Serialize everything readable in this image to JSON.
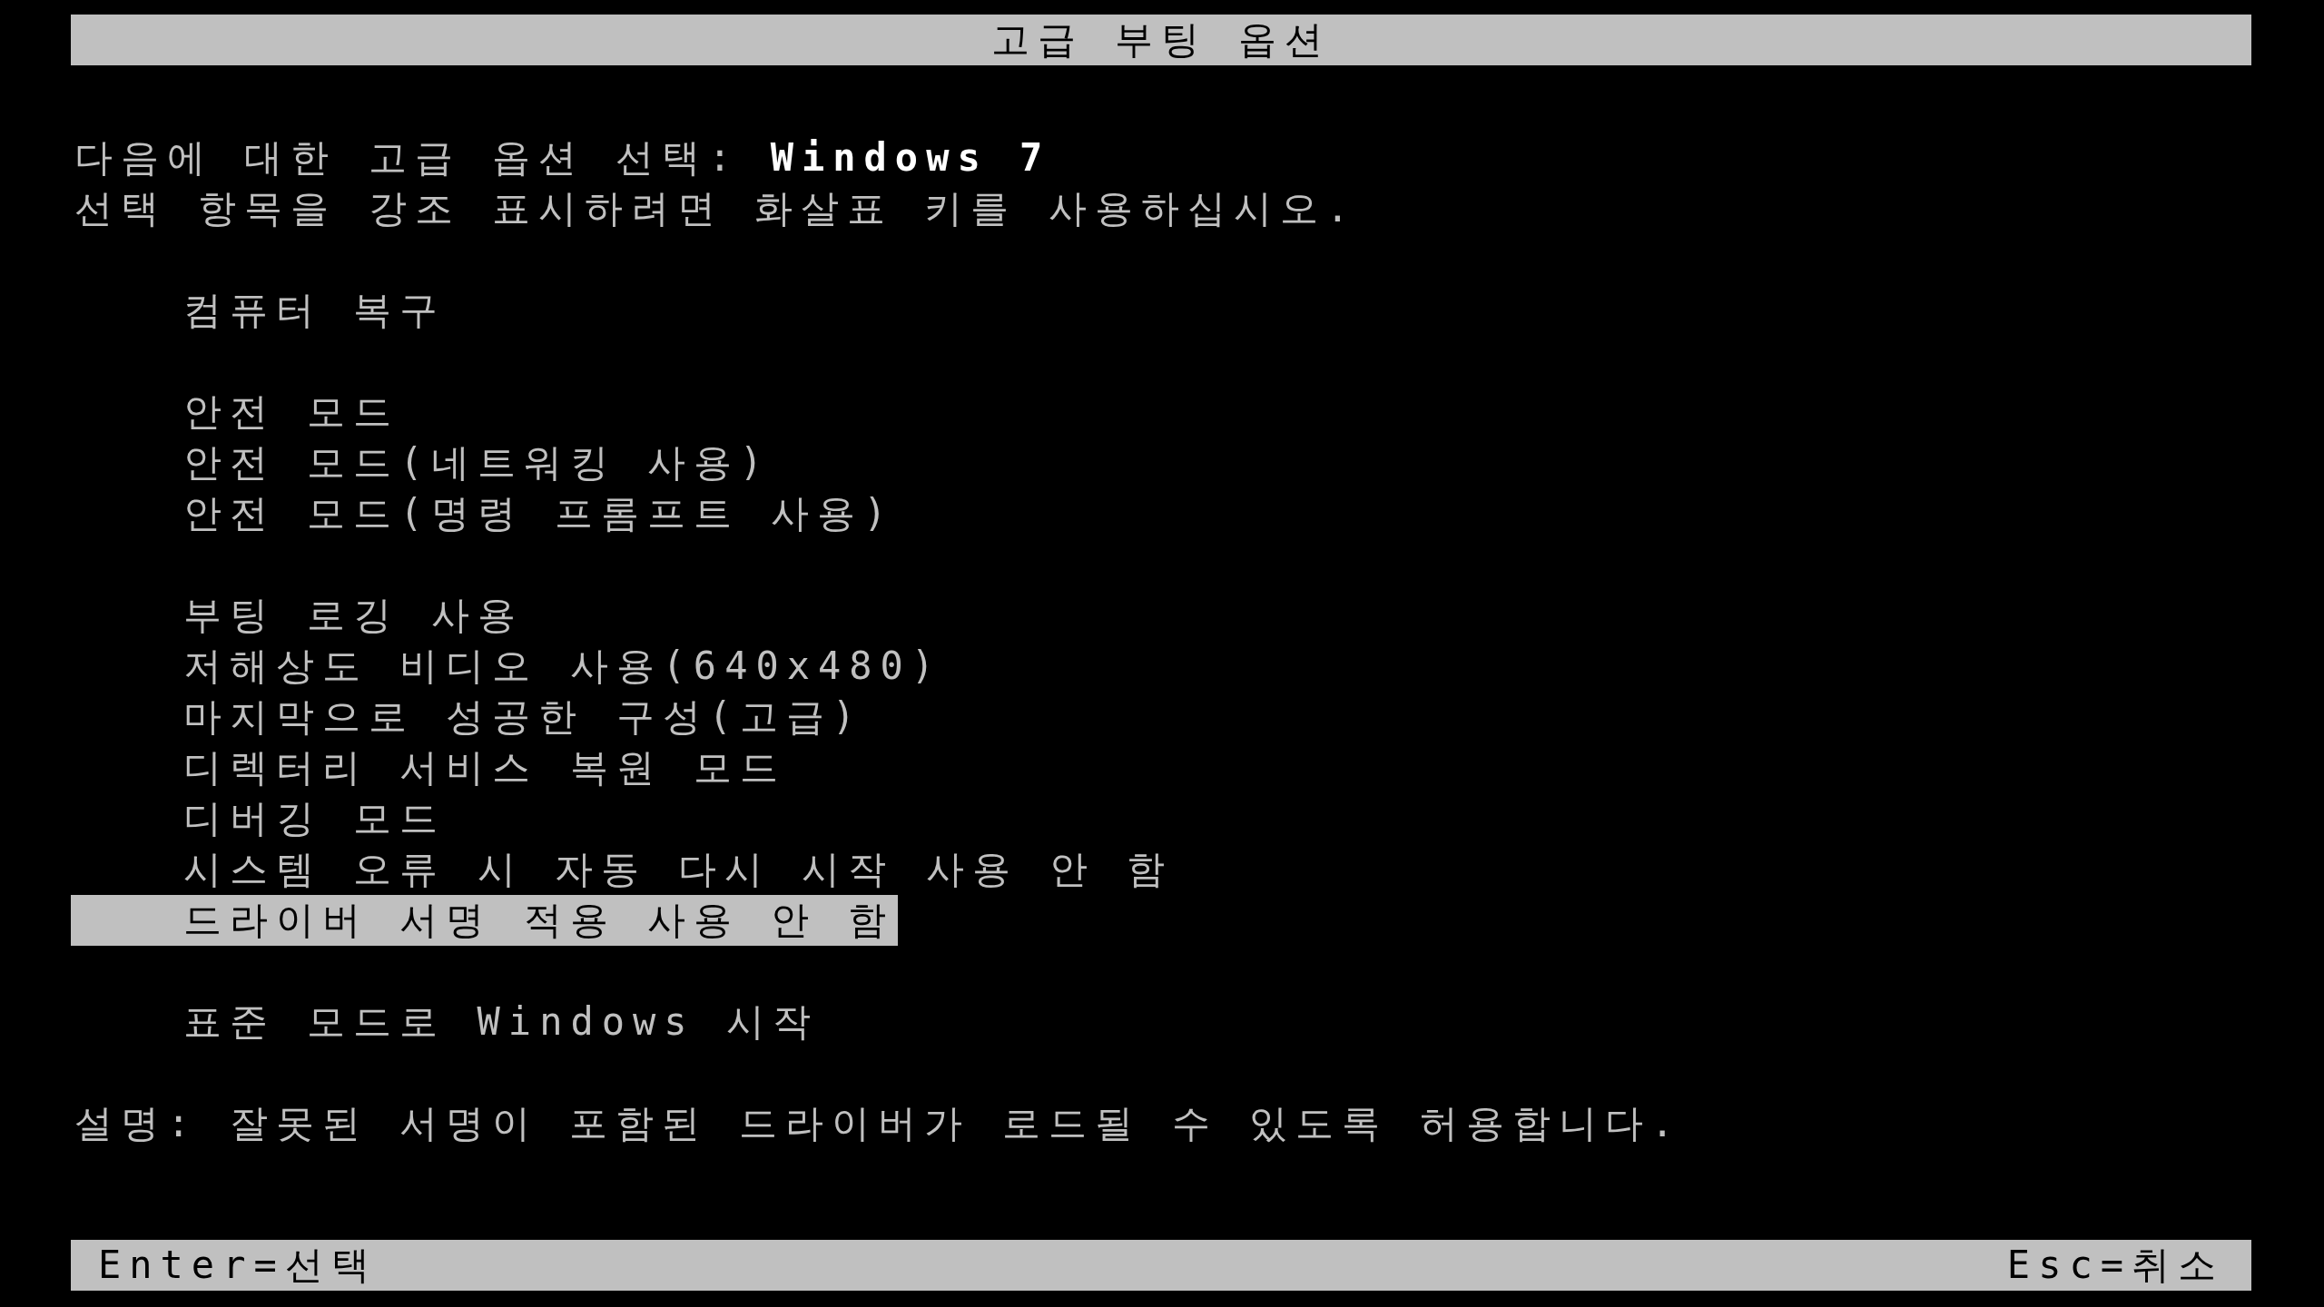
{
  "title_bar": {
    "title": "고급 부팅 옵션"
  },
  "header": [
    "다음에 대한 고급 옵션 선택: **Windows 7**",
    "선택 항목을 강조 표시하려면 화살표 키를 사용하십시오."
  ],
  "menu": {
    "groups": [
      {
        "items": [
          {
            "label": "컴퓨터 복구",
            "selected": false
          }
        ]
      },
      {
        "items": [
          {
            "label": "안전 모드",
            "selected": false
          },
          {
            "label": "안전 모드(네트워킹 사용)",
            "selected": false
          },
          {
            "label": "안전 모드(명령 프롬프트 사용)",
            "selected": false
          }
        ]
      },
      {
        "items": [
          {
            "label": "부팅 로깅 사용",
            "selected": false
          },
          {
            "label": "저해상도 비디오 사용(640x480)",
            "selected": false
          },
          {
            "label": "마지막으로 성공한 구성(고급)",
            "selected": false
          },
          {
            "label": "디렉터리 서비스 복원 모드",
            "selected": false
          },
          {
            "label": "디버깅 모드",
            "selected": false
          },
          {
            "label": "시스템 오류 시 자동 다시 시작 사용 안 함",
            "selected": false
          },
          {
            "label": "드라이버 서명 적용 사용 안 함",
            "selected": true
          }
        ]
      },
      {
        "items": [
          {
            "label": "표준 모드로 Windows 시작",
            "selected": false
          }
        ]
      }
    ]
  },
  "description": "설명: 잘못된 서명이 포함된 드라이버가 로드될 수 있도록 허용합니다.",
  "status_bar": {
    "left": "Enter=선택",
    "right": "Esc=취소"
  }
}
